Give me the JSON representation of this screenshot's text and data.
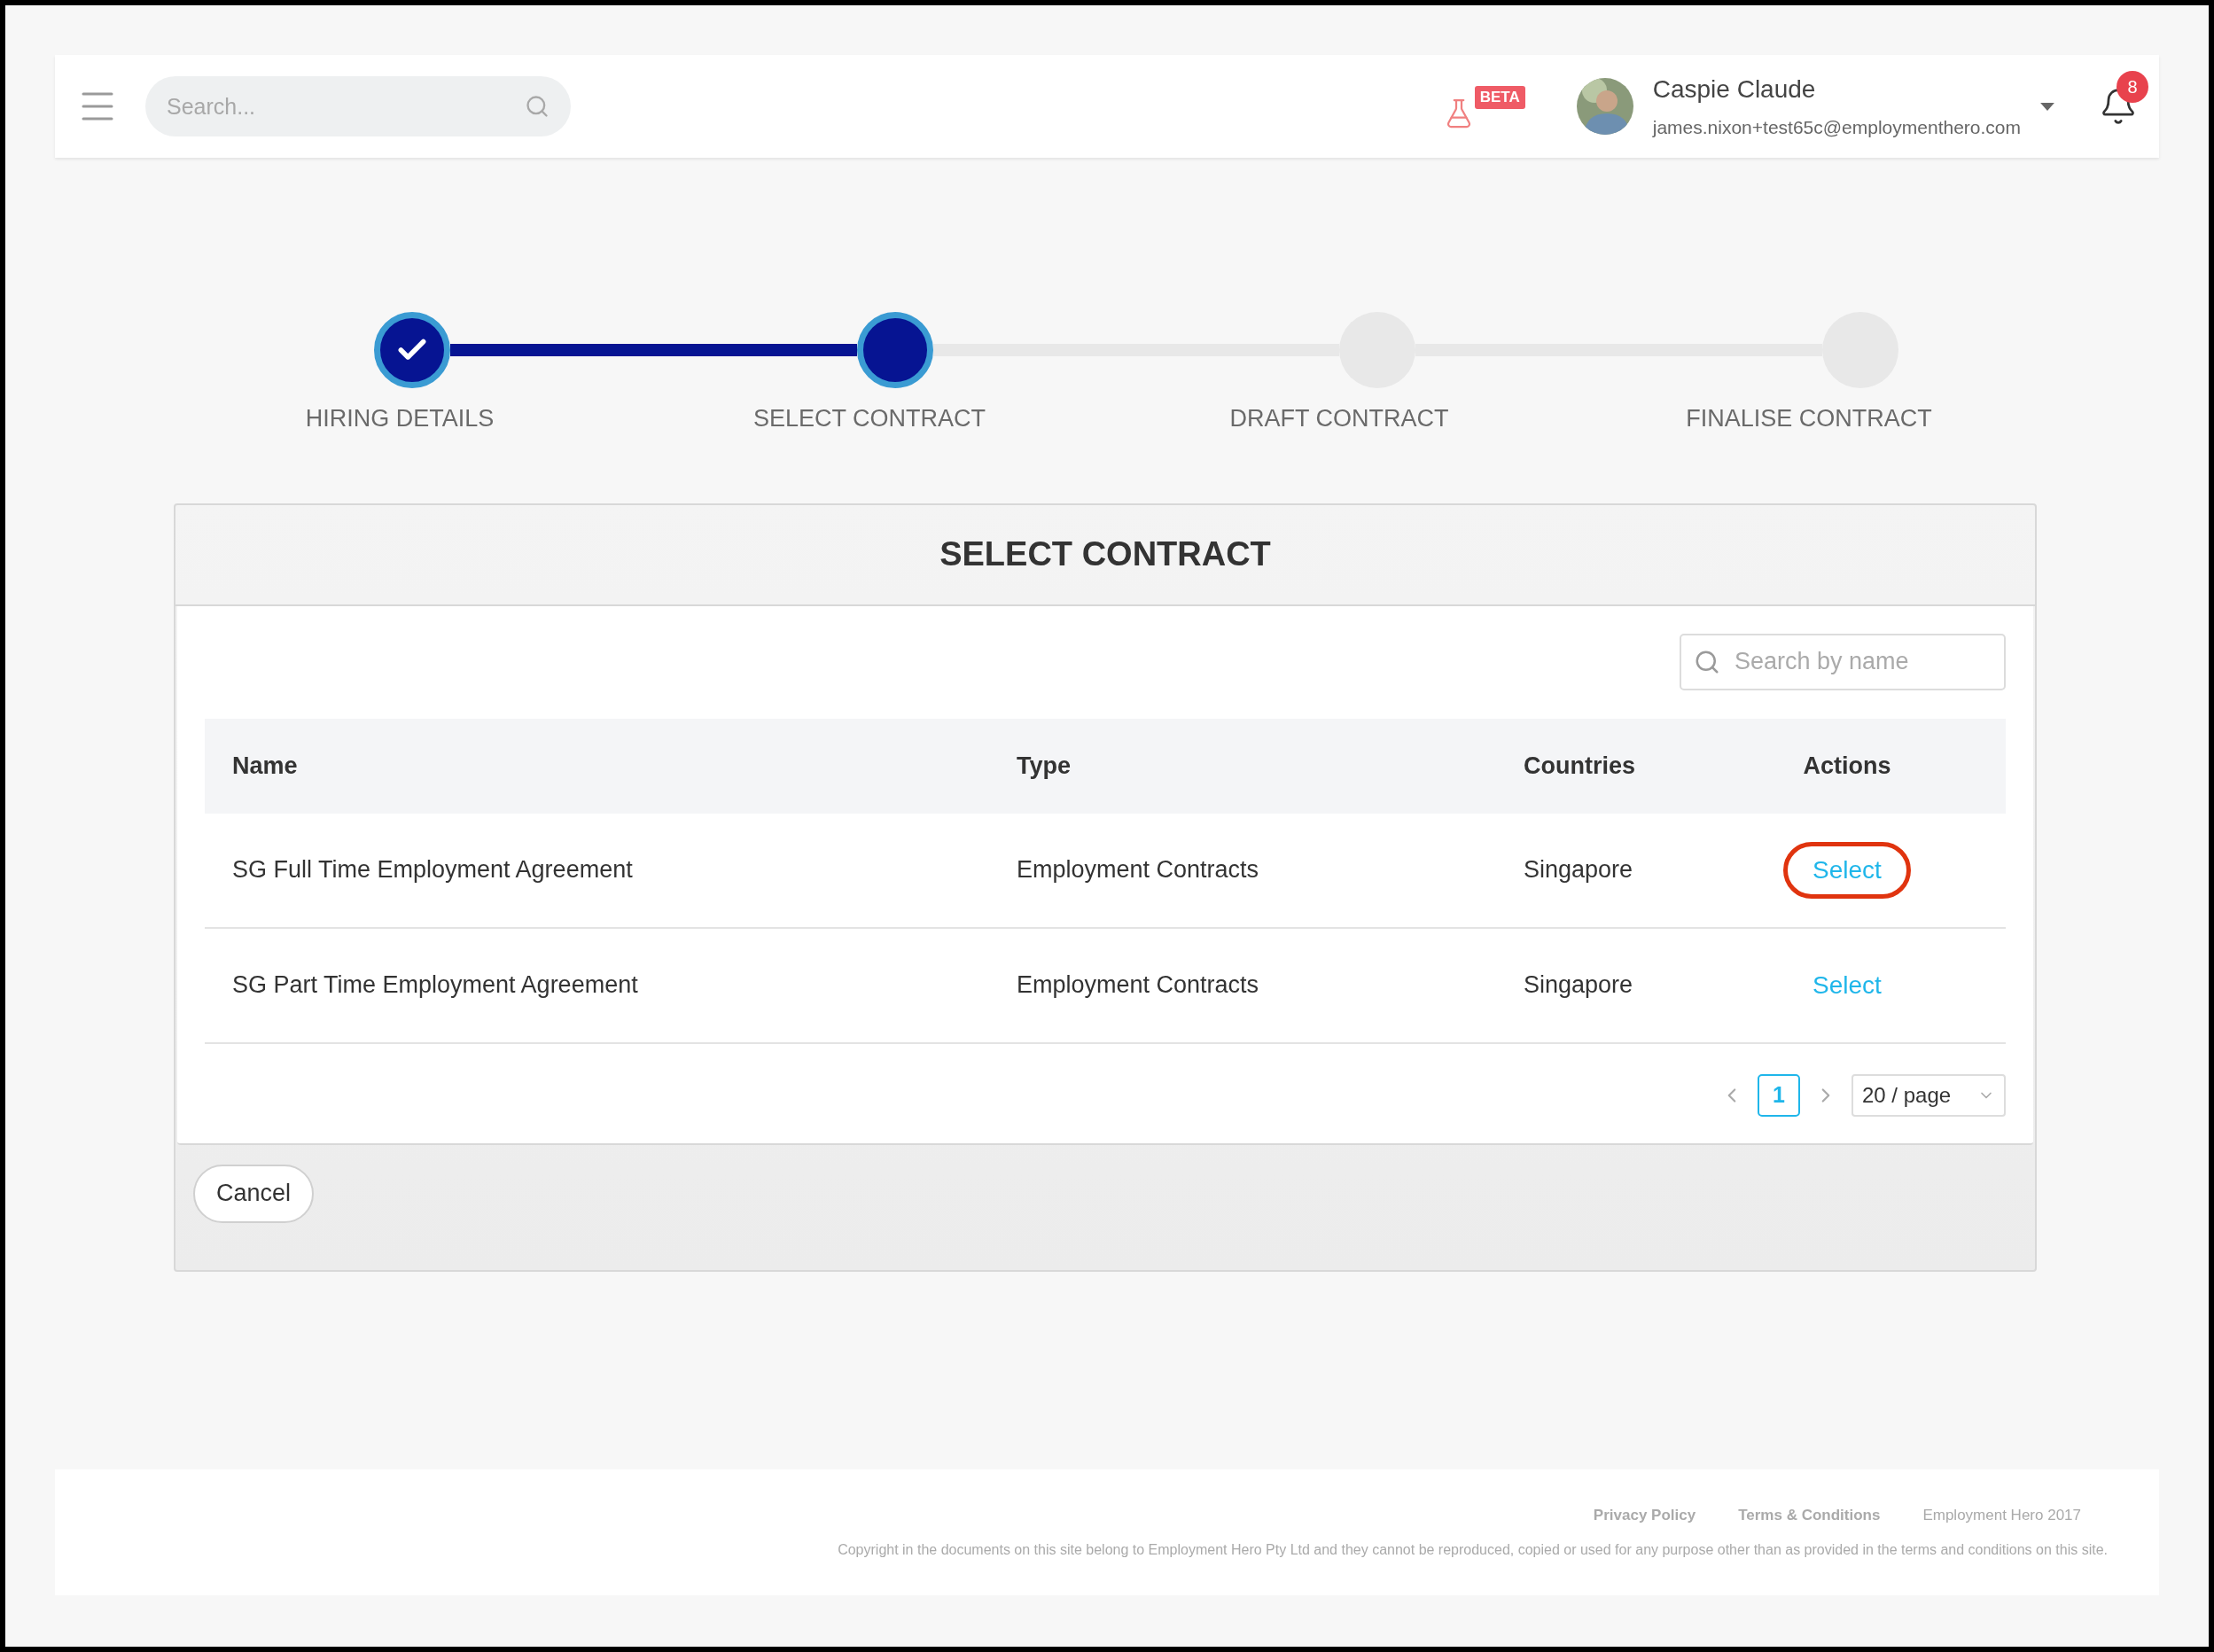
{
  "header": {
    "search": {
      "placeholder": "Search..."
    },
    "beta_badge": "BETA",
    "user": {
      "name": "Caspie Claude",
      "email": "james.nixon+test65c@employmenthero.com"
    },
    "notifications": {
      "count": "8"
    }
  },
  "stepper": [
    {
      "label": "HIRING DETAILS",
      "completed": true,
      "current": false
    },
    {
      "label": "SELECT CONTRACT",
      "completed": false,
      "current": true
    },
    {
      "label": "DRAFT CONTRACT",
      "completed": false,
      "current": false
    },
    {
      "label": "FINALISE CONTRACT",
      "completed": false,
      "current": false
    }
  ],
  "card": {
    "title": "SELECT CONTRACT",
    "search": {
      "placeholder": "Search by name"
    },
    "table": {
      "columns": [
        "Name",
        "Type",
        "Countries",
        "Actions"
      ],
      "rows": [
        {
          "name": "SG Full Time Employment Agreement",
          "type": "Employment Contracts",
          "countries": "Singapore",
          "action": "Select",
          "highlighted": true
        },
        {
          "name": "SG Part Time Employment Agreement",
          "type": "Employment Contracts",
          "countries": "Singapore",
          "action": "Select",
          "highlighted": false
        }
      ]
    },
    "pagination": {
      "pages": [
        {
          "label": "1",
          "selected": true
        }
      ],
      "page_size": "20 / page"
    },
    "cancel": "Cancel"
  },
  "footer": {
    "links": [
      "Privacy Policy",
      "Terms & Conditions"
    ],
    "brand": "Employment Hero 2017",
    "copyright": "Copyright in the documents on this site belong to Employment Hero Pty Ltd and they cannot be reproduced, copied or used for any purpose other than as provided in the terms and conditions on this site."
  }
}
